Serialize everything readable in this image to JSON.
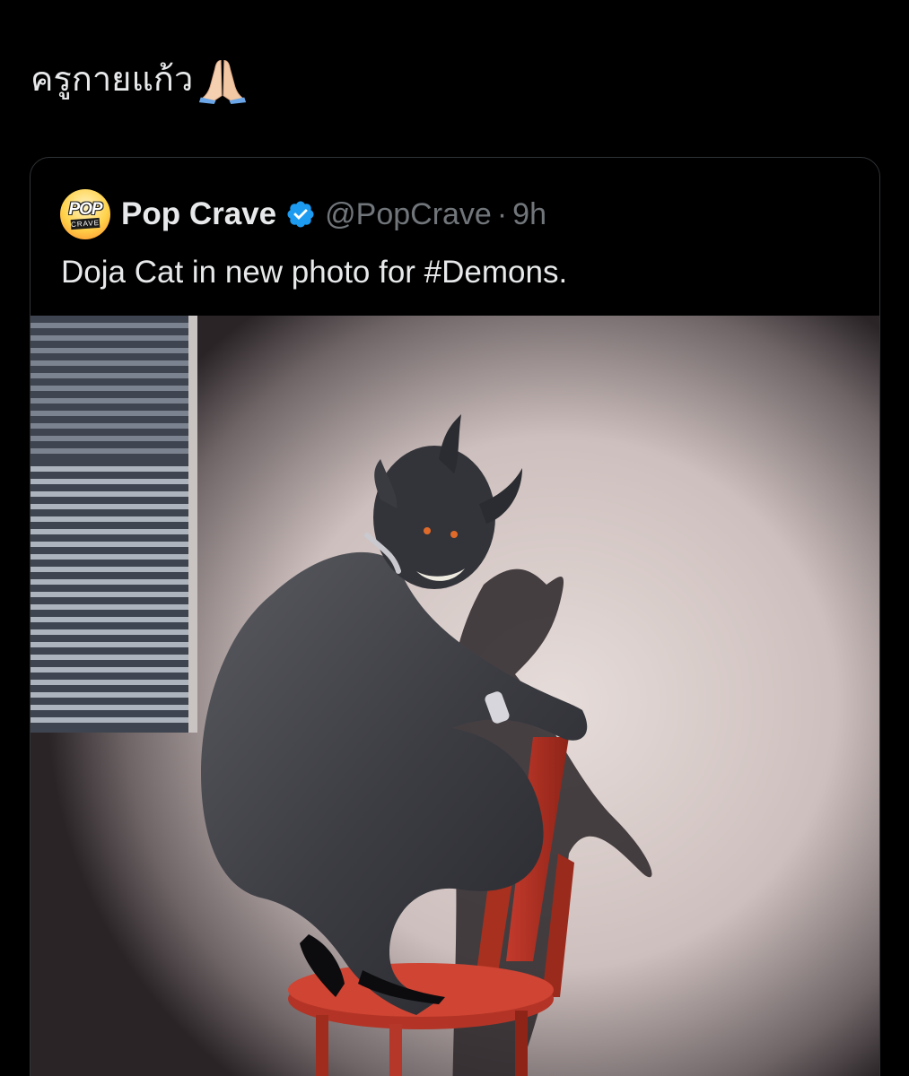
{
  "post": {
    "text": "ครูกายแก้ว",
    "emoji_icon": "folded-hands-emoji"
  },
  "quote": {
    "avatar": {
      "line1": "POP",
      "line2": "CRAVE"
    },
    "display_name": "Pop Crave",
    "verified_icon": "verified-badge-icon",
    "handle": "@PopCrave",
    "separator": "·",
    "time": "9h",
    "text": "Doja Cat in new photo for #Demons.",
    "media_icon": "photo-demon-on-red-chair"
  },
  "colors": {
    "background": "#000000",
    "text_primary": "#e7e9ea",
    "text_secondary": "#71767b",
    "border": "#2f3336",
    "verified": "#1d9bf0"
  }
}
